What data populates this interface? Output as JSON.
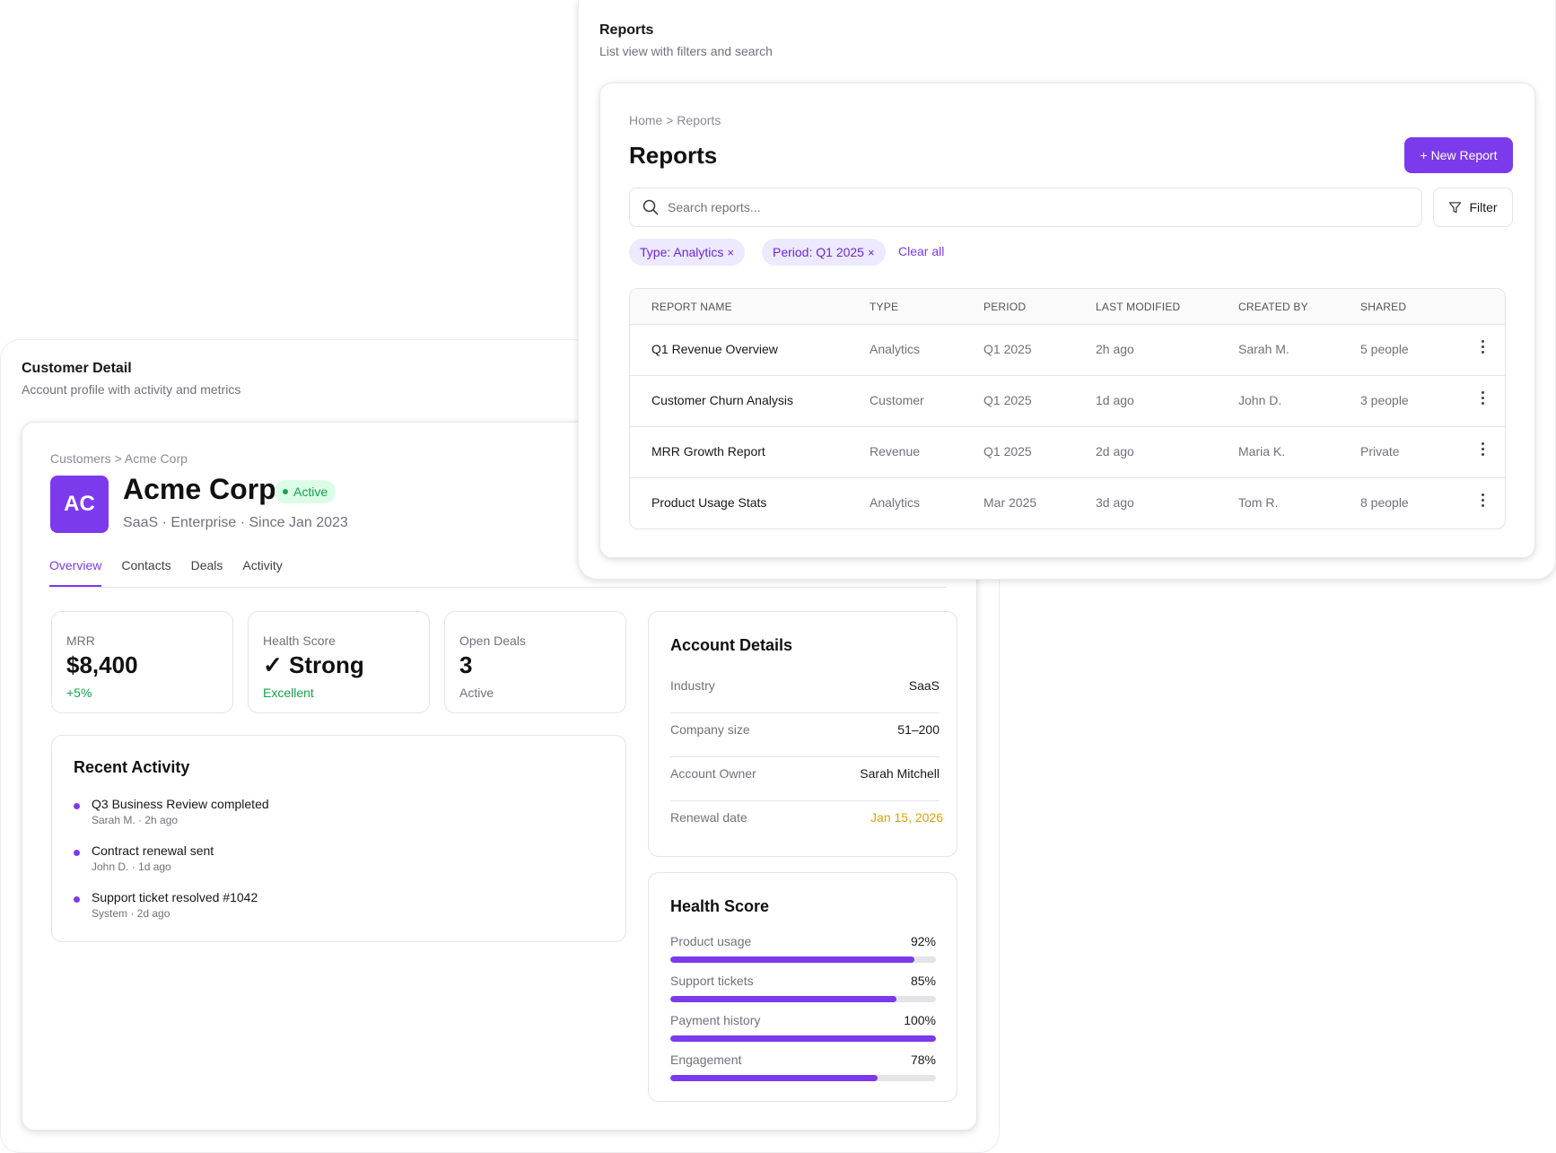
{
  "reports_panel": {
    "title": "Reports",
    "subtitle": "List view with filters and search",
    "breadcrumb": "Home > Reports",
    "page_title": "Reports",
    "new_button": "+ New Report",
    "search_placeholder": "Search reports...",
    "filter_button": "Filter",
    "chips": [
      "Type: Analytics",
      "Period: Q1 2025"
    ],
    "chip_remove_glyph": "×",
    "clear_all": "Clear all",
    "columns": [
      "REPORT NAME",
      "TYPE",
      "PERIOD",
      "LAST MODIFIED",
      "CREATED BY",
      "SHARED"
    ],
    "rows": [
      [
        "Q1 Revenue Overview",
        "Analytics",
        "Q1 2025",
        "2h ago",
        "Sarah M.",
        "5 people"
      ],
      [
        "Customer Churn Analysis",
        "Customer",
        "Q1 2025",
        "1d ago",
        "John D.",
        "3 people"
      ],
      [
        "MRR Growth Report",
        "Revenue",
        "Q1 2025",
        "2d ago",
        "Maria K.",
        "Private"
      ],
      [
        "Product Usage Stats",
        "Analytics",
        "Mar 2025",
        "3d ago",
        "Tom R.",
        "8 people"
      ]
    ]
  },
  "customer_panel": {
    "title": "Customer Detail",
    "subtitle": "Account profile with activity and metrics",
    "breadcrumb": "Customers > Acme Corp",
    "avatar_initials": "AC",
    "name": "Acme Corp",
    "status": "Active",
    "meta": "SaaS · Enterprise · Since Jan 2023",
    "tabs": [
      "Overview",
      "Contacts",
      "Deals",
      "Activity"
    ],
    "active_tab": "Overview",
    "kpis": [
      {
        "label": "MRR",
        "value": "$8,400",
        "sub": "+5%"
      },
      {
        "label": "Health Score",
        "value": "✓ Strong",
        "sub": "Excellent"
      },
      {
        "label": "Open Deals",
        "value": "3",
        "sub": "Active"
      }
    ],
    "recent_activity": {
      "title": "Recent Activity",
      "items": [
        {
          "text": "Q3 Business Review completed",
          "meta": "Sarah M. · 2h ago"
        },
        {
          "text": "Contract renewal sent",
          "meta": "John D. · 1d ago"
        },
        {
          "text": "Support ticket resolved #1042",
          "meta": "System · 2d ago"
        }
      ]
    },
    "account_details": {
      "title": "Account Details",
      "rows": [
        {
          "key": "Industry",
          "value": "SaaS"
        },
        {
          "key": "Company size",
          "value": "51–200"
        },
        {
          "key": "Account Owner",
          "value": "Sarah Mitchell"
        },
        {
          "key": "Renewal date",
          "value": "Jan 15, 2026"
        }
      ]
    },
    "health_score": {
      "title": "Health Score",
      "rows": [
        {
          "key": "Product usage",
          "value": "92%",
          "fraction": 0.92
        },
        {
          "key": "Support tickets",
          "value": "85%",
          "fraction": 0.85
        },
        {
          "key": "Payment history",
          "value": "100%",
          "fraction": 1.0
        },
        {
          "key": "Engagement",
          "value": "78%",
          "fraction": 0.78
        }
      ]
    }
  },
  "colors": {
    "accent": "#7c3aed",
    "success": "#16a34a",
    "warning": "#e0a106",
    "muted": "#71717a"
  },
  "icons": {
    "search": "search-icon",
    "filter": "filter-icon",
    "menu": "more-vertical-icon",
    "check": "check-icon",
    "status_dot": "dot-icon"
  }
}
